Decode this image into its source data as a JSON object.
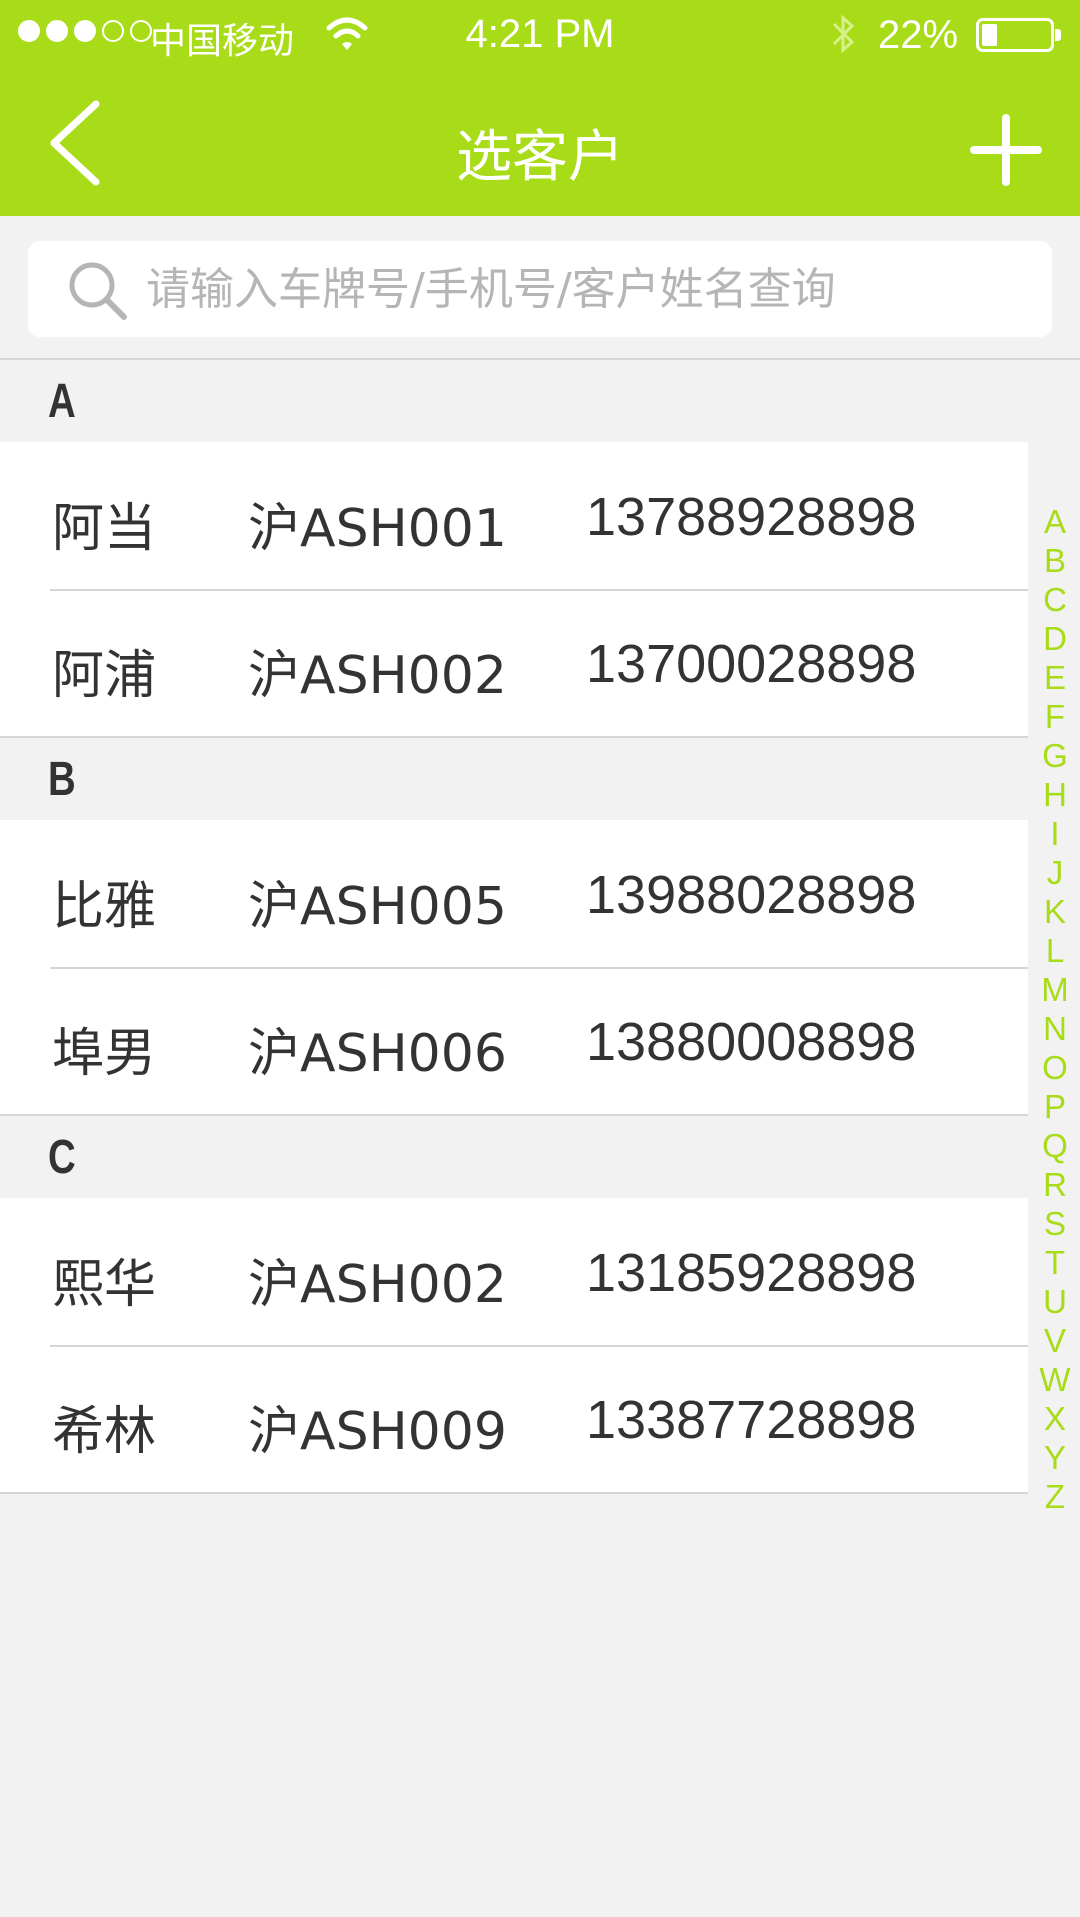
{
  "status_bar": {
    "signal": "●●●○○",
    "carrier": "中国移动",
    "time": "4:21 PM",
    "battery": "22%"
  },
  "nav": {
    "title": "选客户"
  },
  "search": {
    "placeholder": "请输入车牌号/手机号/客户姓名查询",
    "value": ""
  },
  "sections": [
    {
      "letter": "A",
      "customers": [
        {
          "name": "阿当",
          "plate": "沪ASH001",
          "phone": "13788928898"
        },
        {
          "name": "阿浦",
          "plate": "沪ASH002",
          "phone": "13700028898"
        }
      ]
    },
    {
      "letter": "B",
      "customers": [
        {
          "name": "比雅",
          "plate": "沪ASH005",
          "phone": "13988028898"
        },
        {
          "name": "埠男",
          "plate": "沪ASH006",
          "phone": "13880008898"
        }
      ]
    },
    {
      "letter": "C",
      "customers": [
        {
          "name": "熙华",
          "plate": "沪ASH002",
          "phone": "13185928898"
        },
        {
          "name": "希林",
          "plate": "沪ASH009",
          "phone": "13387728898"
        }
      ]
    }
  ],
  "index_letters": [
    "A",
    "B",
    "C",
    "D",
    "E",
    "F",
    "G",
    "H",
    "I",
    "J",
    "K",
    "L",
    "M",
    "N",
    "O",
    "P",
    "Q",
    "R",
    "S",
    "T",
    "U",
    "V",
    "W",
    "X",
    "Y",
    "Z"
  ],
  "colors": {
    "accent": "#a9dc18",
    "background": "#f2f2f2",
    "text": "#333333",
    "placeholder": "#b5b5b5"
  }
}
